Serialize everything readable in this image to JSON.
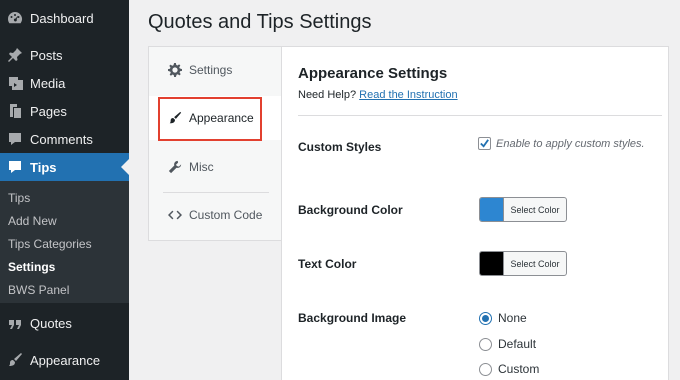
{
  "colors": {
    "sidebar_bg": "#1d2327",
    "submenu_bg": "#2c3338",
    "accent": "#2271b1",
    "highlight": "#e2402f",
    "bg_color_swatch": "#2d86d1",
    "text_color_swatch": "#000000"
  },
  "sidebar": {
    "items": [
      {
        "label": "Dashboard",
        "icon": "dashboard-icon"
      },
      {
        "label": "Posts",
        "icon": "pushpin-icon"
      },
      {
        "label": "Media",
        "icon": "media-icon"
      },
      {
        "label": "Pages",
        "icon": "pages-icon"
      },
      {
        "label": "Comments",
        "icon": "comments-icon"
      },
      {
        "label": "Tips",
        "icon": "tips-icon"
      },
      {
        "label": "Quotes",
        "icon": "quote-icon"
      },
      {
        "label": "Appearance",
        "icon": "paintbrush-icon"
      }
    ],
    "submenu": [
      "Tips",
      "Add New",
      "Tips Categories",
      "Settings",
      "BWS Panel"
    ]
  },
  "page": {
    "title": "Quotes and Tips Settings"
  },
  "tabs": [
    {
      "label": "Settings",
      "icon": "gear-icon"
    },
    {
      "label": "Appearance",
      "icon": "paintbrush-icon"
    },
    {
      "label": "Misc",
      "icon": "wrench-icon"
    },
    {
      "label": "Custom Code",
      "icon": "code-icon"
    }
  ],
  "panel": {
    "title": "Appearance Settings",
    "help_prefix": "Need Help?",
    "help_link": "Read the Instruction",
    "custom_styles": {
      "label": "Custom Styles",
      "checked": true,
      "desc": "Enable to apply custom styles."
    },
    "background_color": {
      "label": "Background Color",
      "button": "Select Color"
    },
    "text_color": {
      "label": "Text Color",
      "button": "Select Color"
    },
    "background_image": {
      "label": "Background Image",
      "options": [
        "None",
        "Default",
        "Custom"
      ],
      "selected": "None"
    }
  }
}
